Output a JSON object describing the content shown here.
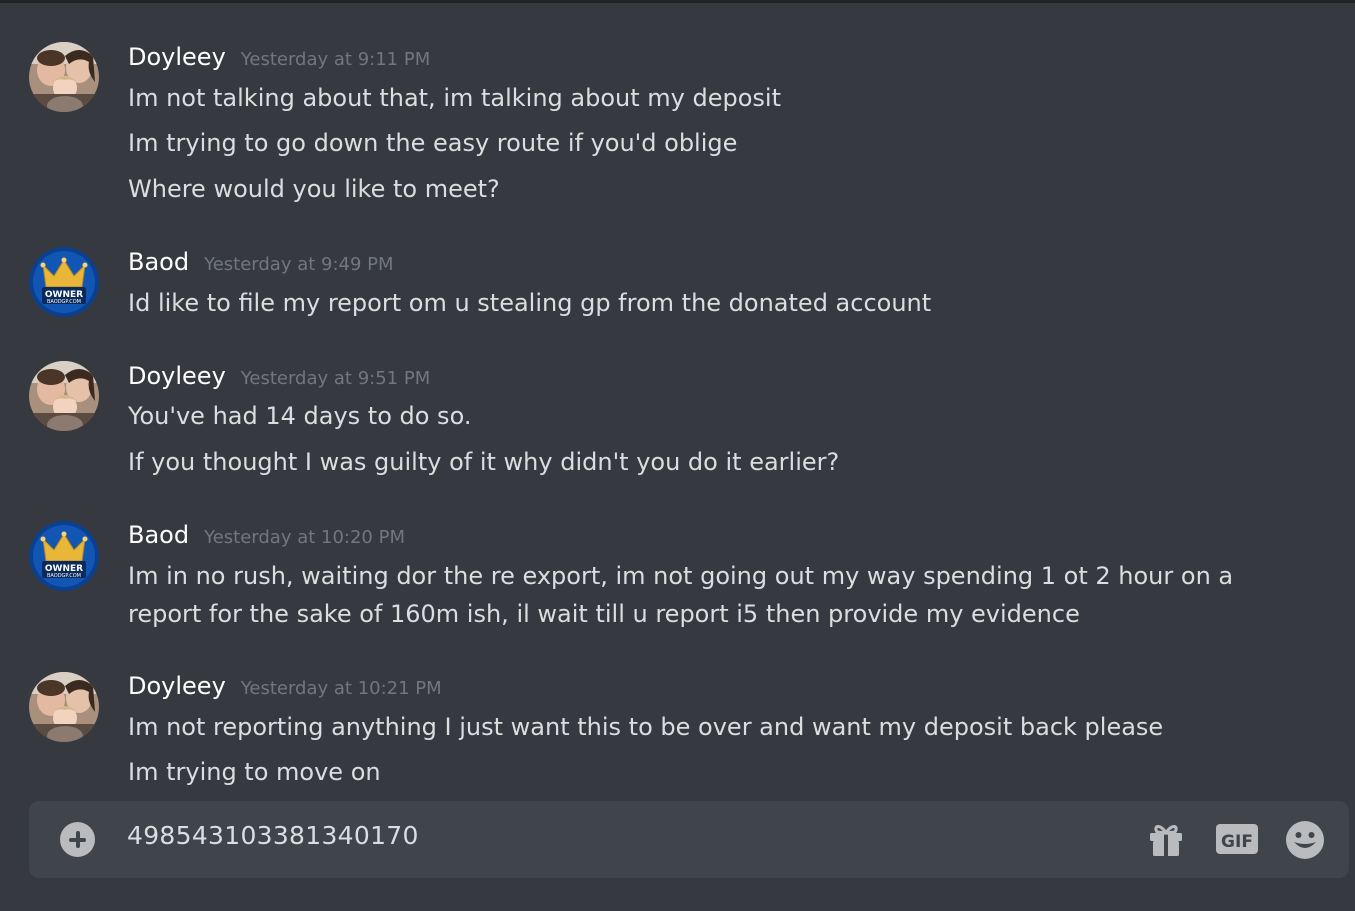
{
  "messages": [
    {
      "author": "Doyleey",
      "timestamp": "Yesterday at 9:11 PM",
      "lines": [
        "Im not talking about that, im talking about my deposit",
        "Im trying to go down the easy route if you'd oblige",
        "Where would you like to meet?"
      ]
    },
    {
      "author": "Baod",
      "timestamp": "Yesterday at 9:49 PM",
      "lines": [
        "Id like to file my report om u stealing gp from the donated account"
      ]
    },
    {
      "author": "Doyleey",
      "timestamp": "Yesterday at 9:51 PM",
      "lines": [
        "You've had 14 days to do so.",
        "If you thought I was guilty of it why didn't you do it earlier?"
      ]
    },
    {
      "author": "Baod",
      "timestamp": "Yesterday at 10:20 PM",
      "lines": [
        "Im in no rush, waiting dor the re export, im not going out my way spending 1 ot 2 hour on a report for the sake of 160m ish, il wait till u report i5 then provide my evidence"
      ]
    },
    {
      "author": "Doyleey",
      "timestamp": "Yesterday at 10:21 PM",
      "lines": [
        "Im not reporting anything I just want this to be over and want my deposit back please",
        "Im trying to move on"
      ]
    }
  ],
  "badge": {
    "line1": "OWNER",
    "line2": "BAODGP.COM"
  },
  "composer": {
    "value": "498543103381340170"
  },
  "icons": {
    "attach": "plus-circle-icon",
    "gift": "gift-icon",
    "gif": "GIF",
    "emoji": "smile-emoji-icon"
  },
  "colors": {
    "background": "#36393f",
    "composer": "#40444b",
    "username": "#ffffff",
    "timestamp": "#72767d",
    "text": "#dcddde",
    "icon": "#b9bbbe",
    "badge_bg": "#0b3f8f",
    "badge_crown": "#e8b73a"
  }
}
